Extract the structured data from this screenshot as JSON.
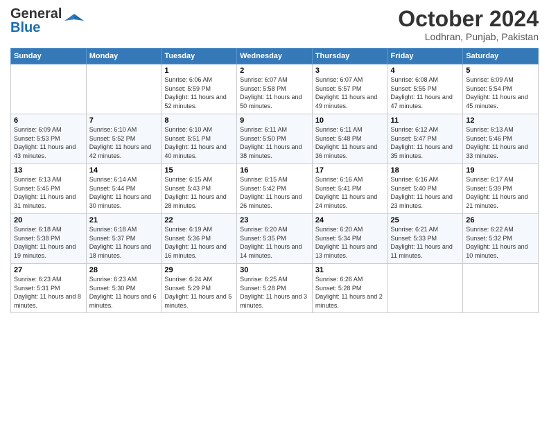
{
  "header": {
    "logo_general": "General",
    "logo_blue": "Blue",
    "month": "October 2024",
    "location": "Lodhran, Punjab, Pakistan"
  },
  "weekdays": [
    "Sunday",
    "Monday",
    "Tuesday",
    "Wednesday",
    "Thursday",
    "Friday",
    "Saturday"
  ],
  "weeks": [
    [
      {
        "day": "",
        "sunrise": "",
        "sunset": "",
        "daylight": ""
      },
      {
        "day": "",
        "sunrise": "",
        "sunset": "",
        "daylight": ""
      },
      {
        "day": "1",
        "sunrise": "Sunrise: 6:06 AM",
        "sunset": "Sunset: 5:59 PM",
        "daylight": "Daylight: 11 hours and 52 minutes."
      },
      {
        "day": "2",
        "sunrise": "Sunrise: 6:07 AM",
        "sunset": "Sunset: 5:58 PM",
        "daylight": "Daylight: 11 hours and 50 minutes."
      },
      {
        "day": "3",
        "sunrise": "Sunrise: 6:07 AM",
        "sunset": "Sunset: 5:57 PM",
        "daylight": "Daylight: 11 hours and 49 minutes."
      },
      {
        "day": "4",
        "sunrise": "Sunrise: 6:08 AM",
        "sunset": "Sunset: 5:55 PM",
        "daylight": "Daylight: 11 hours and 47 minutes."
      },
      {
        "day": "5",
        "sunrise": "Sunrise: 6:09 AM",
        "sunset": "Sunset: 5:54 PM",
        "daylight": "Daylight: 11 hours and 45 minutes."
      }
    ],
    [
      {
        "day": "6",
        "sunrise": "Sunrise: 6:09 AM",
        "sunset": "Sunset: 5:53 PM",
        "daylight": "Daylight: 11 hours and 43 minutes."
      },
      {
        "day": "7",
        "sunrise": "Sunrise: 6:10 AM",
        "sunset": "Sunset: 5:52 PM",
        "daylight": "Daylight: 11 hours and 42 minutes."
      },
      {
        "day": "8",
        "sunrise": "Sunrise: 6:10 AM",
        "sunset": "Sunset: 5:51 PM",
        "daylight": "Daylight: 11 hours and 40 minutes."
      },
      {
        "day": "9",
        "sunrise": "Sunrise: 6:11 AM",
        "sunset": "Sunset: 5:50 PM",
        "daylight": "Daylight: 11 hours and 38 minutes."
      },
      {
        "day": "10",
        "sunrise": "Sunrise: 6:11 AM",
        "sunset": "Sunset: 5:48 PM",
        "daylight": "Daylight: 11 hours and 36 minutes."
      },
      {
        "day": "11",
        "sunrise": "Sunrise: 6:12 AM",
        "sunset": "Sunset: 5:47 PM",
        "daylight": "Daylight: 11 hours and 35 minutes."
      },
      {
        "day": "12",
        "sunrise": "Sunrise: 6:13 AM",
        "sunset": "Sunset: 5:46 PM",
        "daylight": "Daylight: 11 hours and 33 minutes."
      }
    ],
    [
      {
        "day": "13",
        "sunrise": "Sunrise: 6:13 AM",
        "sunset": "Sunset: 5:45 PM",
        "daylight": "Daylight: 11 hours and 31 minutes."
      },
      {
        "day": "14",
        "sunrise": "Sunrise: 6:14 AM",
        "sunset": "Sunset: 5:44 PM",
        "daylight": "Daylight: 11 hours and 30 minutes."
      },
      {
        "day": "15",
        "sunrise": "Sunrise: 6:15 AM",
        "sunset": "Sunset: 5:43 PM",
        "daylight": "Daylight: 11 hours and 28 minutes."
      },
      {
        "day": "16",
        "sunrise": "Sunrise: 6:15 AM",
        "sunset": "Sunset: 5:42 PM",
        "daylight": "Daylight: 11 hours and 26 minutes."
      },
      {
        "day": "17",
        "sunrise": "Sunrise: 6:16 AM",
        "sunset": "Sunset: 5:41 PM",
        "daylight": "Daylight: 11 hours and 24 minutes."
      },
      {
        "day": "18",
        "sunrise": "Sunrise: 6:16 AM",
        "sunset": "Sunset: 5:40 PM",
        "daylight": "Daylight: 11 hours and 23 minutes."
      },
      {
        "day": "19",
        "sunrise": "Sunrise: 6:17 AM",
        "sunset": "Sunset: 5:39 PM",
        "daylight": "Daylight: 11 hours and 21 minutes."
      }
    ],
    [
      {
        "day": "20",
        "sunrise": "Sunrise: 6:18 AM",
        "sunset": "Sunset: 5:38 PM",
        "daylight": "Daylight: 11 hours and 19 minutes."
      },
      {
        "day": "21",
        "sunrise": "Sunrise: 6:18 AM",
        "sunset": "Sunset: 5:37 PM",
        "daylight": "Daylight: 11 hours and 18 minutes."
      },
      {
        "day": "22",
        "sunrise": "Sunrise: 6:19 AM",
        "sunset": "Sunset: 5:36 PM",
        "daylight": "Daylight: 11 hours and 16 minutes."
      },
      {
        "day": "23",
        "sunrise": "Sunrise: 6:20 AM",
        "sunset": "Sunset: 5:35 PM",
        "daylight": "Daylight: 11 hours and 14 minutes."
      },
      {
        "day": "24",
        "sunrise": "Sunrise: 6:20 AM",
        "sunset": "Sunset: 5:34 PM",
        "daylight": "Daylight: 11 hours and 13 minutes."
      },
      {
        "day": "25",
        "sunrise": "Sunrise: 6:21 AM",
        "sunset": "Sunset: 5:33 PM",
        "daylight": "Daylight: 11 hours and 11 minutes."
      },
      {
        "day": "26",
        "sunrise": "Sunrise: 6:22 AM",
        "sunset": "Sunset: 5:32 PM",
        "daylight": "Daylight: 11 hours and 10 minutes."
      }
    ],
    [
      {
        "day": "27",
        "sunrise": "Sunrise: 6:23 AM",
        "sunset": "Sunset: 5:31 PM",
        "daylight": "Daylight: 11 hours and 8 minutes."
      },
      {
        "day": "28",
        "sunrise": "Sunrise: 6:23 AM",
        "sunset": "Sunset: 5:30 PM",
        "daylight": "Daylight: 11 hours and 6 minutes."
      },
      {
        "day": "29",
        "sunrise": "Sunrise: 6:24 AM",
        "sunset": "Sunset: 5:29 PM",
        "daylight": "Daylight: 11 hours and 5 minutes."
      },
      {
        "day": "30",
        "sunrise": "Sunrise: 6:25 AM",
        "sunset": "Sunset: 5:28 PM",
        "daylight": "Daylight: 11 hours and 3 minutes."
      },
      {
        "day": "31",
        "sunrise": "Sunrise: 6:26 AM",
        "sunset": "Sunset: 5:28 PM",
        "daylight": "Daylight: 11 hours and 2 minutes."
      },
      {
        "day": "",
        "sunrise": "",
        "sunset": "",
        "daylight": ""
      },
      {
        "day": "",
        "sunrise": "",
        "sunset": "",
        "daylight": ""
      }
    ]
  ]
}
